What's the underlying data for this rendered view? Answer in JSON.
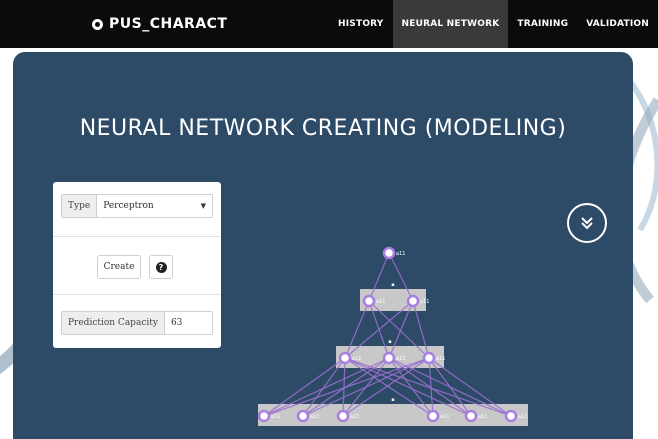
{
  "brand": {
    "name": "PUS_CHARACT",
    "icon": "circle-logo-icon"
  },
  "nav": {
    "items": [
      {
        "label": "HISTORY",
        "active": false
      },
      {
        "label": "NEURAL NETWORK",
        "active": true
      },
      {
        "label": "TRAINING",
        "active": false
      },
      {
        "label": "VALIDATION",
        "active": false
      }
    ]
  },
  "page": {
    "title": "NEURAL NETWORK CREATING (MODELING)"
  },
  "form": {
    "type_label": "Type",
    "type_value": "Perceptron",
    "create_label": "Create",
    "help_glyph": "?",
    "capacity_label": "Prediction Capacity",
    "capacity_value": "63"
  },
  "network": {
    "node_label": "a11",
    "layer_sizes": [
      1,
      2,
      3,
      7
    ]
  },
  "colors": {
    "navbar": "#0b0b0b",
    "panel": "#2d4a66",
    "link_purple": "#9a6fd0",
    "node_purple": "#a87fe0",
    "layer_box": "#c8c8c8"
  }
}
